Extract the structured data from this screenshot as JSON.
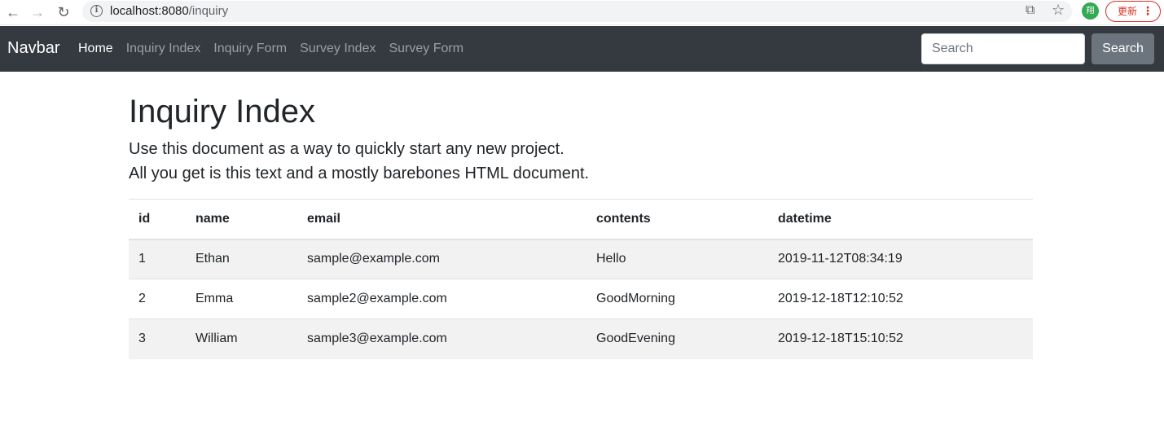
{
  "browser": {
    "url_host": "localhost:8080",
    "url_path": "/inquiry",
    "avatar_initial": "翔",
    "update_label": "更新"
  },
  "navbar": {
    "brand": "Navbar",
    "links": [
      "Home",
      "Inquiry Index",
      "Inquiry Form",
      "Survey Index",
      "Survey Form"
    ],
    "active_index": 0,
    "search_placeholder": "Search",
    "search_button": "Search",
    "bg_color": "#343a40"
  },
  "page": {
    "title": "Inquiry Index",
    "lead_line1": "Use this document as a way to quickly start any new project.",
    "lead_line2": "All you get is this text and a mostly barebones HTML document."
  },
  "table": {
    "headers": [
      "id",
      "name",
      "email",
      "contents",
      "datetime"
    ],
    "rows": [
      [
        "1",
        "Ethan",
        "sample@example.com",
        "Hello",
        "2019-11-12T08:34:19"
      ],
      [
        "2",
        "Emma",
        "sample2@example.com",
        "GoodMorning",
        "2019-12-18T12:10:52"
      ],
      [
        "3",
        "William",
        "sample3@example.com",
        "GoodEvening",
        "2019-12-18T15:10:52"
      ]
    ]
  },
  "icons": {
    "back": "back-arrow-icon",
    "forward": "forward-arrow-icon",
    "reload": "reload-icon",
    "info": "info-icon",
    "share": "share-icon",
    "bookmark": "star-icon",
    "menu": "kebab-menu-icon"
  }
}
